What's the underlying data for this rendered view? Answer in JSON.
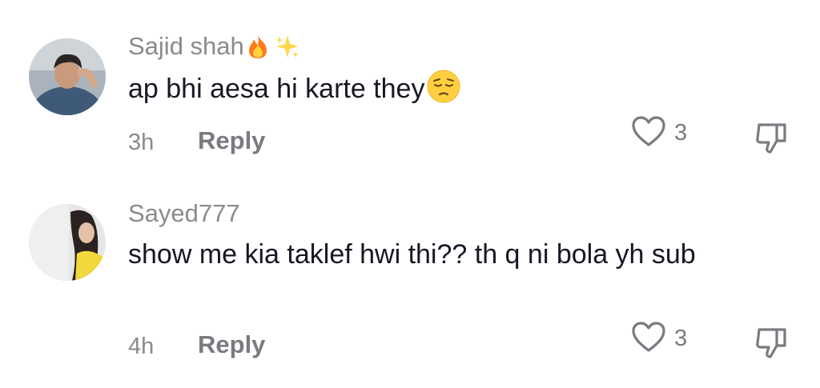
{
  "comments": [
    {
      "username": "Sajid shah",
      "username_emojis": [
        "fire-emoji",
        "sparkles-emoji"
      ],
      "text": "ap bhi aesa hi karte they",
      "text_emoji": "pensive-face-emoji",
      "time": "3h",
      "reply_label": "Reply",
      "like_count": "3"
    },
    {
      "username": "Sayed777",
      "text": "show me kia taklef hwi thi?? th q ni bola yh sub",
      "time": "4h",
      "reply_label": "Reply",
      "like_count": "3"
    }
  ],
  "colors": {
    "username": "#8a8a8f",
    "text": "#161823",
    "meta": "#7a7a80",
    "background": "#ffffff"
  }
}
